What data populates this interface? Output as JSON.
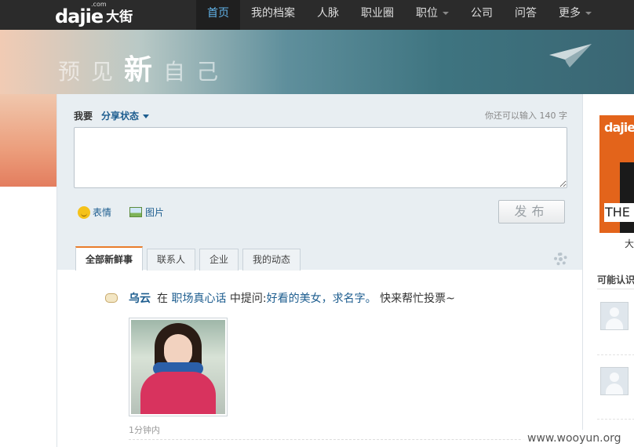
{
  "header": {
    "logo_text": "dajie",
    "logo_cn": "大街",
    "logo_com": ".com",
    "nav": [
      {
        "label": "首页",
        "active": true
      },
      {
        "label": "我的档案"
      },
      {
        "label": "人脉"
      },
      {
        "label": "职业圈"
      },
      {
        "label": "职位",
        "dropdown": true
      },
      {
        "label": "公司"
      },
      {
        "label": "问答"
      },
      {
        "label": "更多",
        "dropdown": true
      }
    ]
  },
  "banner": {
    "slogan": [
      "预",
      "见",
      "新",
      "自",
      "己"
    ]
  },
  "composer": {
    "prefix": "我要",
    "mode": "分享状态",
    "char_count": "你还可以输入 140 字",
    "input_value": "",
    "emoji_label": "表情",
    "image_label": "图片",
    "publish_label": "发布"
  },
  "tabs": [
    {
      "label": "全部新鲜事",
      "active": true
    },
    {
      "label": "联系人"
    },
    {
      "label": "企业"
    },
    {
      "label": "我的动态"
    }
  ],
  "feed": [
    {
      "author": "乌云",
      "in_word": "在",
      "circle": "职场真心话",
      "action": "中提问:",
      "question": "好看的美女，求名字。",
      "extra": "快来帮忙投票~",
      "time": "1分钟内"
    }
  ],
  "sidebar": {
    "ad_logo": "dajie",
    "ad_text": "THE",
    "ad_caption": "大",
    "may_know_title": "可能认识"
  },
  "colors": {
    "nav_bg": "#2b2b2b",
    "nav_active": "#61b3e8",
    "link": "#1d5d8f",
    "tab_accent": "#e97d2b",
    "ad_orange": "#e3641b"
  },
  "watermark": "www.wooyun.org"
}
